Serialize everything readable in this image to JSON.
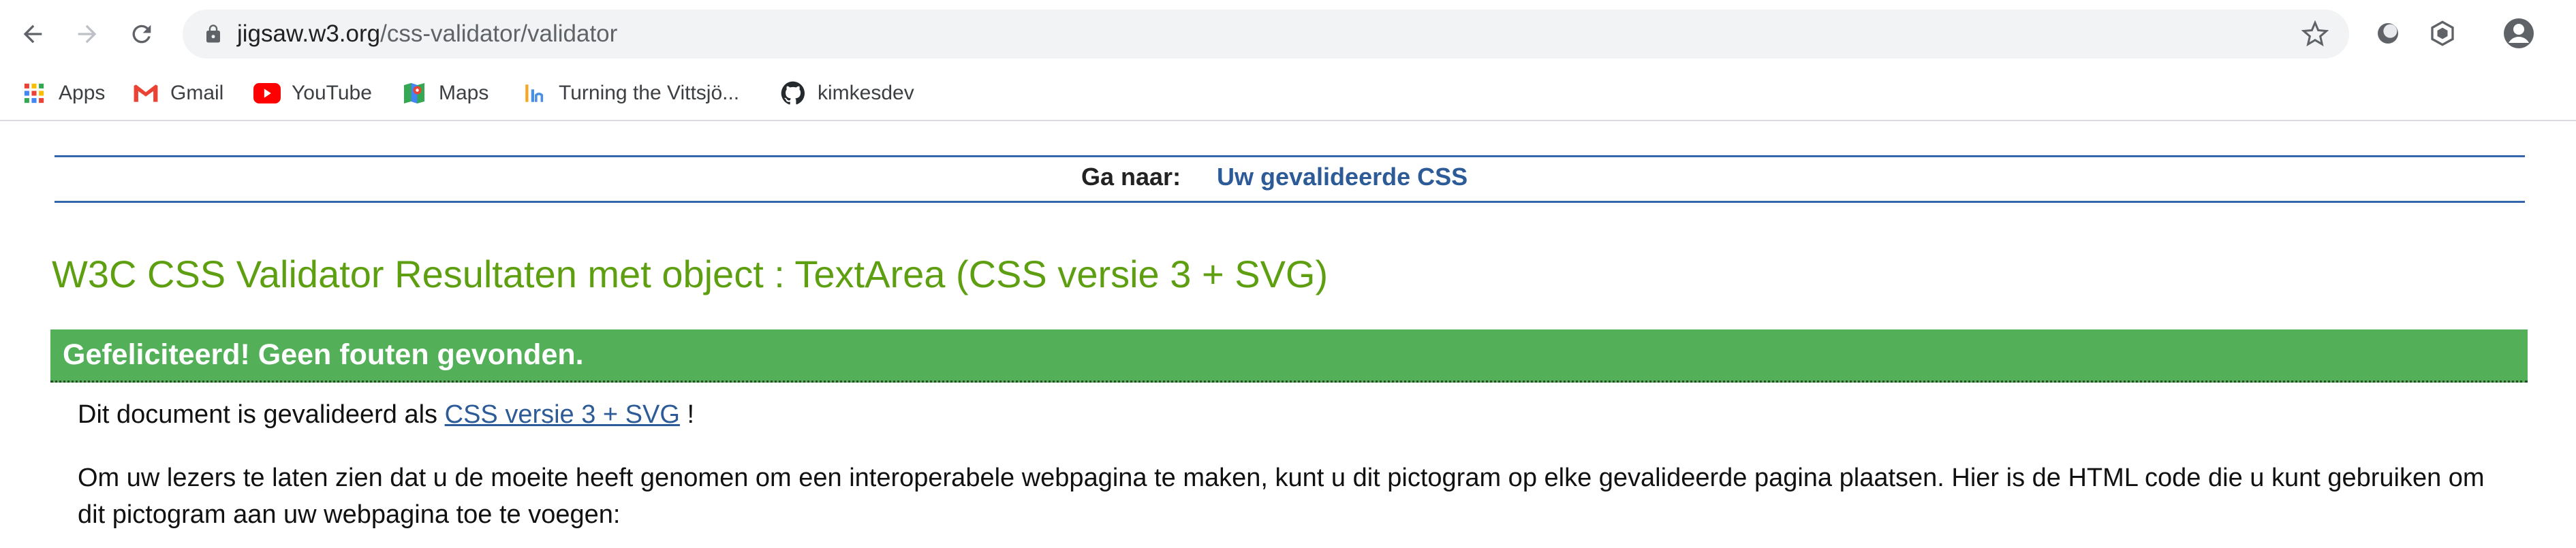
{
  "browser": {
    "url_host": "jigsaw.w3.org",
    "url_path": "/css-validator/validator",
    "bookmarks": [
      {
        "label": "Apps",
        "icon": "apps-grid-icon"
      },
      {
        "label": "Gmail",
        "icon": "gmail-icon"
      },
      {
        "label": "YouTube",
        "icon": "youtube-icon"
      },
      {
        "label": "Maps",
        "icon": "maps-icon"
      },
      {
        "label": "Turning the Vittsjö...",
        "icon": "bookmark-site-icon"
      },
      {
        "label": "kimkesdev",
        "icon": "github-icon"
      }
    ]
  },
  "nav": {
    "label": "Ga naar:",
    "link": "Uw gevalideerde CSS"
  },
  "page": {
    "title": "W3C CSS Validator Resultaten met object : TextArea (CSS versie 3 + SVG)",
    "success": "Gefeliciteerd! Geen fouten gevonden.",
    "validated_prefix": "Dit document is gevalideerd als",
    "validated_link": "CSS versie 3 + SVG",
    "validated_suffix": " !",
    "icon_text": "Om uw lezers te laten zien dat u de moeite heeft genomen om een interoperabele webpagina te maken, kunt u dit pictogram op elke gevalideerde pagina plaatsen. Hier is de HTML code die u kunt gebruiken om dit pictogram aan uw webpagina toe te voegen:"
  },
  "colors": {
    "title_green": "#5e9f12",
    "success_bg": "#53b059",
    "link_blue": "#2c5b97",
    "rule_blue": "#3366aa"
  }
}
